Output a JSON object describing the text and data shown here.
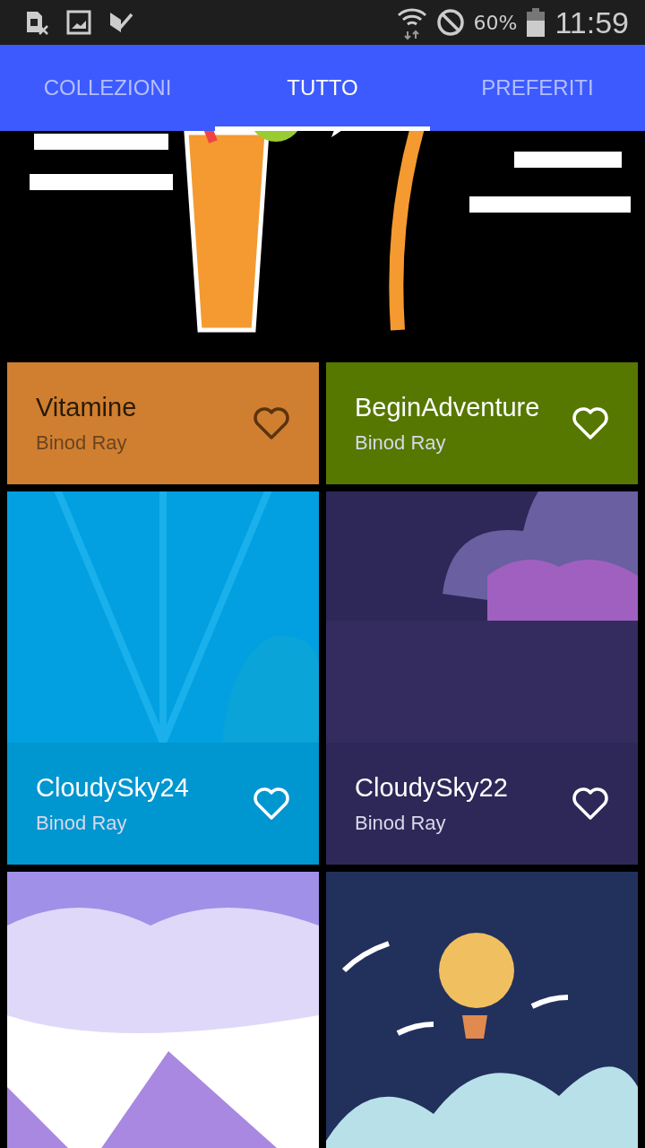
{
  "status_bar": {
    "battery": "60%",
    "time": "11:59"
  },
  "tabs": [
    {
      "label": "COLLEZIONI",
      "selected": false
    },
    {
      "label": "TUTTO",
      "selected": true
    },
    {
      "label": "PREFERITI",
      "selected": false
    }
  ],
  "wallpapers": [
    {
      "kind": "drink",
      "title": "Vitamine",
      "author": "Binod Ray",
      "color": "#d07f30"
    },
    {
      "kind": "palm",
      "title": "BeginAdventure",
      "author": "Binod Ray",
      "color": "#567800"
    },
    {
      "kind": "rays",
      "title": "CloudySky24",
      "author": "Binod Ray",
      "color": "#0096d0"
    },
    {
      "kind": "dusk",
      "title": "CloudySky22",
      "author": "Binod Ray",
      "color": "#2e2858"
    },
    {
      "kind": "mountains"
    },
    {
      "kind": "balloon"
    }
  ]
}
